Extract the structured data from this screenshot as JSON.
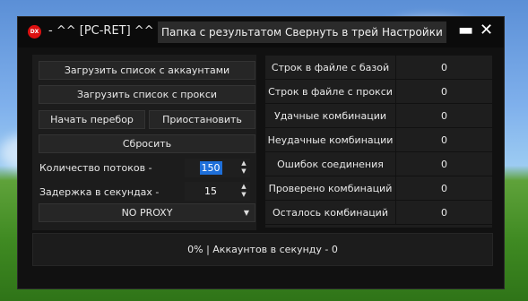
{
  "titlebar": {
    "title": "- ^^ [PC-RET] ^^ -",
    "icon": "dx-logo-icon",
    "menu": [
      "Папка с результатом",
      "Свернуть в трей",
      "Настройки"
    ],
    "minimize_glyph": "▬",
    "close_glyph": "✕"
  },
  "controls": {
    "load_accounts_label": "Загрузить список с аккаунтами",
    "load_proxy_label": "Загрузить список с прокси",
    "start_label": "Начать перебор",
    "pause_label": "Приостановить",
    "reset_label": "Сбросить",
    "threads_label": "Количество потоков -",
    "threads_value": "150",
    "delay_label": "Задержка в секундах -",
    "delay_value": "15",
    "proxy_mode": "NO PROXY"
  },
  "stats": [
    {
      "label": "Строк в файле с базой",
      "value": "0"
    },
    {
      "label": "Строк в файле с прокси",
      "value": "0"
    },
    {
      "label": "Удачные комбинации",
      "value": "0"
    },
    {
      "label": "Неудачные комбинации",
      "value": "0"
    },
    {
      "label": "Ошибок соединения",
      "value": "0"
    },
    {
      "label": "Проверено комбинаций",
      "value": "0"
    },
    {
      "label": "Осталось комбинаций",
      "value": "0"
    }
  ],
  "status": {
    "text": "0% | Аккаунтов в секунду - 0"
  },
  "colors": {
    "window_bg": "#111111",
    "panel_bg": "#1c1c1c",
    "button_bg": "#262626",
    "selection": "#1e6fd9",
    "close_icon_bg": "#dd1111"
  }
}
